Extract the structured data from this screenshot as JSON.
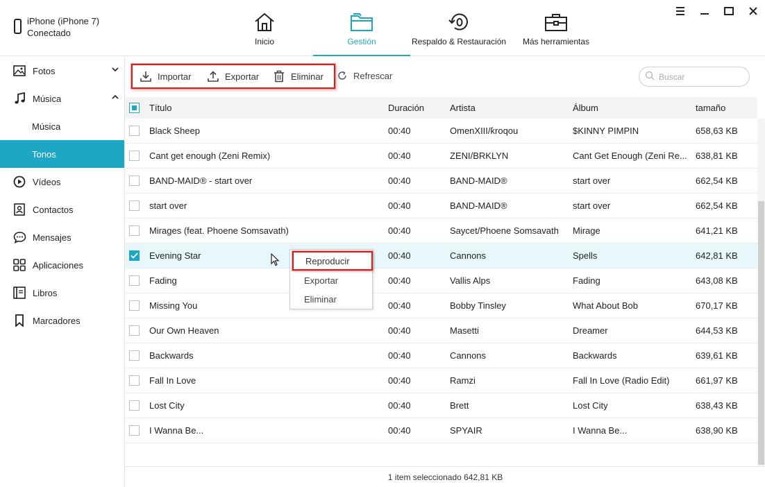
{
  "device": {
    "name": "iPhone (iPhone 7)",
    "status": "Conectado"
  },
  "nav": [
    {
      "label": "Inicio",
      "icon": "home-icon"
    },
    {
      "label": "Gestión",
      "icon": "folder-icon",
      "active": true
    },
    {
      "label": "Respaldo & Restauración",
      "icon": "backup-restore-icon"
    },
    {
      "label": "Más herramientas",
      "icon": "toolbox-icon"
    }
  ],
  "sidebar": {
    "fotos": "Fotos",
    "musica": "Música",
    "musica_sub": "Música",
    "tonos": "Tonos",
    "videos": "Vídeos",
    "contactos": "Contactos",
    "mensajes": "Mensajes",
    "aplicaciones": "Aplicaciones",
    "libros": "Libros",
    "marcadores": "Marcadores"
  },
  "toolbar": {
    "import_label": "Importar",
    "export_label": "Exportar",
    "delete_label": "Eliminar",
    "refresh_label": "Refrescar",
    "search_placeholder": "Buscar"
  },
  "table": {
    "headers": {
      "title": "Título",
      "duration": "Duración",
      "artist": "Artista",
      "album": "Álbum",
      "size": "tamaño"
    },
    "rows": [
      {
        "title": "Black Sheep",
        "duration": "00:40",
        "artist": "OmenXIII/ƙroqou",
        "album": "$KINNY PIMPIN",
        "size": "658,63 KB",
        "checked": false
      },
      {
        "title": "Cant get enough (Zeni Remix)",
        "duration": "00:40",
        "artist": "ZENI/BRKLYN",
        "album": "Cant Get Enough (Zeni Re...",
        "size": "638,81 KB",
        "checked": false
      },
      {
        "title": "BAND-MAID® - start over",
        "duration": "00:40",
        "artist": "BAND-MAID®",
        "album": "start over",
        "size": "662,54 KB",
        "checked": false
      },
      {
        "title": "start over",
        "duration": "00:40",
        "artist": "BAND-MAID®",
        "album": "start over",
        "size": "662,54 KB",
        "checked": false
      },
      {
        "title": "Mirages (feat. Phoene Somsavath)",
        "duration": "00:40",
        "artist": "Saycet/Phoene Somsavath",
        "album": "Mirage",
        "size": "641,21 KB",
        "checked": false
      },
      {
        "title": "Evening Star",
        "duration": "00:40",
        "artist": "Cannons",
        "album": "Spells",
        "size": "642,81 KB",
        "checked": true
      },
      {
        "title": "Fading",
        "duration": "00:40",
        "artist": "Vallis Alps",
        "album": "Fading",
        "size": "643,08 KB",
        "checked": false
      },
      {
        "title": "Missing You",
        "duration": "00:40",
        "artist": "Bobby Tinsley",
        "album": "What About Bob",
        "size": "670,17 KB",
        "checked": false
      },
      {
        "title": "Our Own Heaven",
        "duration": "00:40",
        "artist": "Masetti",
        "album": "Dreamer",
        "size": "644,53 KB",
        "checked": false
      },
      {
        "title": "Backwards",
        "duration": "00:40",
        "artist": "Cannons",
        "album": "Backwards",
        "size": "639,61 KB",
        "checked": false
      },
      {
        "title": "Fall In Love",
        "duration": "00:40",
        "artist": "Ramzi",
        "album": "Fall In Love (Radio Edit)",
        "size": "661,97 KB",
        "checked": false
      },
      {
        "title": "Lost City",
        "duration": "00:40",
        "artist": "Brett",
        "album": "Lost City",
        "size": "638,43 KB",
        "checked": false
      },
      {
        "title": "I Wanna Be...",
        "duration": "00:40",
        "artist": "SPYAIR",
        "album": "I Wanna Be...",
        "size": "638,90 KB",
        "checked": false
      }
    ]
  },
  "context_menu": {
    "play": "Reproducir",
    "export": "Exportar",
    "delete": "Eliminar"
  },
  "status": "1 item seleccionado 642,81 KB",
  "colors": {
    "accent": "#1ea7c4",
    "highlight_box": "#d62020",
    "selected_row": "#e8f7fb"
  }
}
